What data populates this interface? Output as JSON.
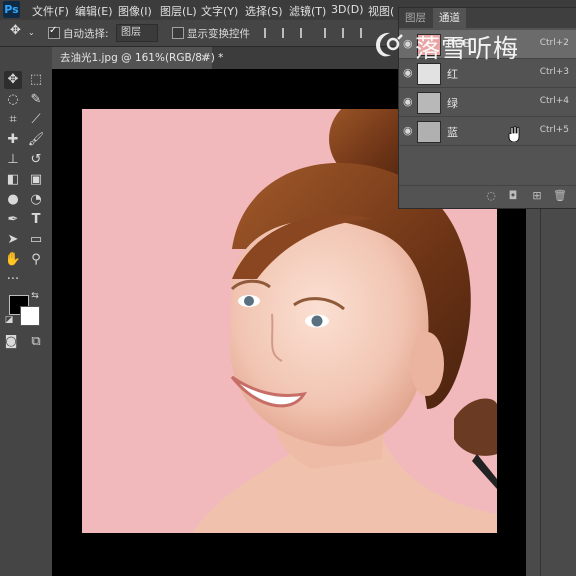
{
  "menubar": {
    "logo": "Ps",
    "items": [
      "文件(F)",
      "编辑(E)",
      "图像(I)",
      "图层(L)",
      "文字(Y)",
      "选择(S)",
      "滤镜(T)",
      "3D(D)",
      "视图("
    ]
  },
  "options": {
    "auto_select_label": "自动选择:",
    "auto_select_value": "图层",
    "show_transform_label": "显示变换控件"
  },
  "document": {
    "tab_title": "去油光1.jpg @ 161%(RGB/8#) *",
    "close_glyph": "×"
  },
  "tools": {
    "move": "move-tool",
    "marquee": "marquee-tool",
    "lasso": "lasso-tool",
    "quick_select": "quick-select-tool",
    "crop": "crop-tool",
    "eyedropper": "eyedropper-tool",
    "healing": "healing-tool",
    "brush": "brush-tool",
    "stamp": "clone-stamp-tool",
    "history_brush": "history-brush-tool",
    "eraser": "eraser-tool",
    "gradient": "gradient-tool",
    "blur": "blur-tool",
    "dodge": "dodge-tool",
    "pen": "pen-tool",
    "type": "type-tool",
    "path_select": "path-select-tool",
    "shape": "shape-tool",
    "hand": "hand-tool",
    "zoom": "zoom-tool",
    "more": "more-tools",
    "foreground_color": "#000000",
    "background_color": "#ffffff"
  },
  "channels_panel": {
    "tabs": [
      "图层",
      "通道"
    ],
    "active_tab": "通道",
    "rows": [
      {
        "name": "RGB",
        "shortcut": "Ctrl+2",
        "selected": true
      },
      {
        "name": "红",
        "shortcut": "Ctrl+3",
        "selected": false
      },
      {
        "name": "绿",
        "shortcut": "Ctrl+4",
        "selected": false
      },
      {
        "name": "蓝",
        "shortcut": "Ctrl+5",
        "selected": false
      }
    ]
  },
  "watermark": {
    "text": "落雪听梅"
  },
  "colors": {
    "photo_background": "#f1b9bb",
    "accent_ps": "#31a8ff"
  }
}
